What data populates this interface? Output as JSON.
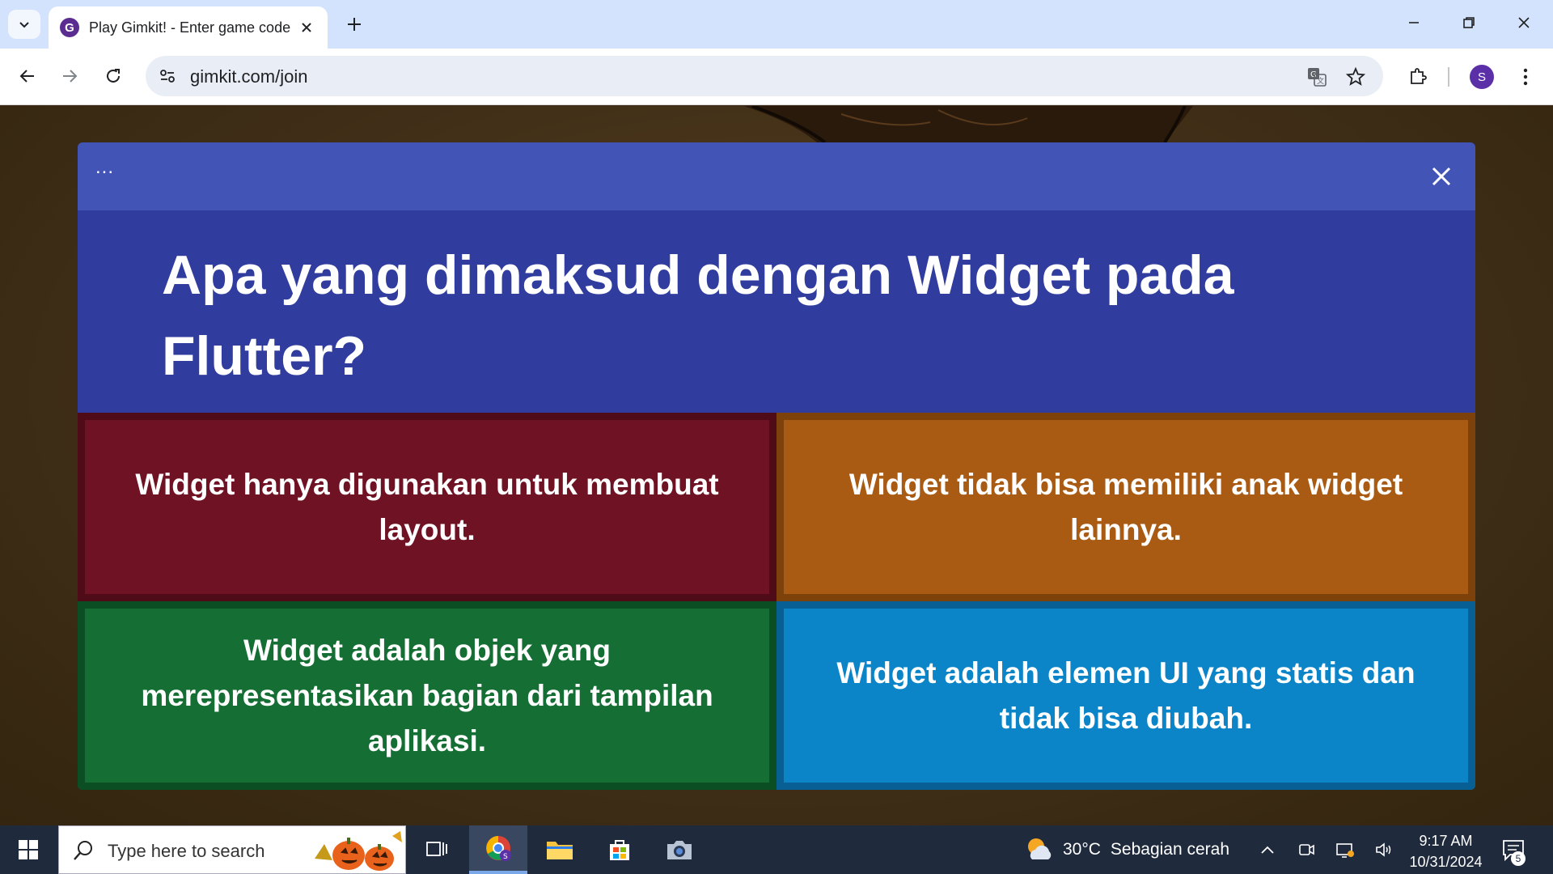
{
  "browser": {
    "tab_title": "Play Gimkit! - Enter game code",
    "favicon_letter": "G",
    "url": "gimkit.com/join",
    "profile_initial": "S"
  },
  "modal": {
    "menu_label": "...",
    "question": "Apa yang dimaksud dengan Widget pada Flutter?",
    "answers": [
      {
        "text": "Widget hanya digunakan untuk membuat layout.",
        "color": "#6f1223"
      },
      {
        "text": "Widget tidak bisa memiliki anak widget lainnya.",
        "color": "#a95b14"
      },
      {
        "text": "Widget adalah objek yang merepresentasikan bagian dari tampilan aplikasi.",
        "color": "#156f34"
      },
      {
        "text": "Widget adalah elemen UI yang statis dan tidak bisa diubah.",
        "color": "#0b84c8"
      }
    ]
  },
  "taskbar": {
    "search_placeholder": "Type here to search",
    "weather_temp": "30°C",
    "weather_desc": "Sebagian cerah",
    "time": "9:17 AM",
    "date": "10/31/2024",
    "notification_count": "5",
    "apps": [
      "task-view-icon",
      "chrome-icon",
      "file-explorer-icon",
      "microsoft-store-icon",
      "camera-icon"
    ]
  }
}
